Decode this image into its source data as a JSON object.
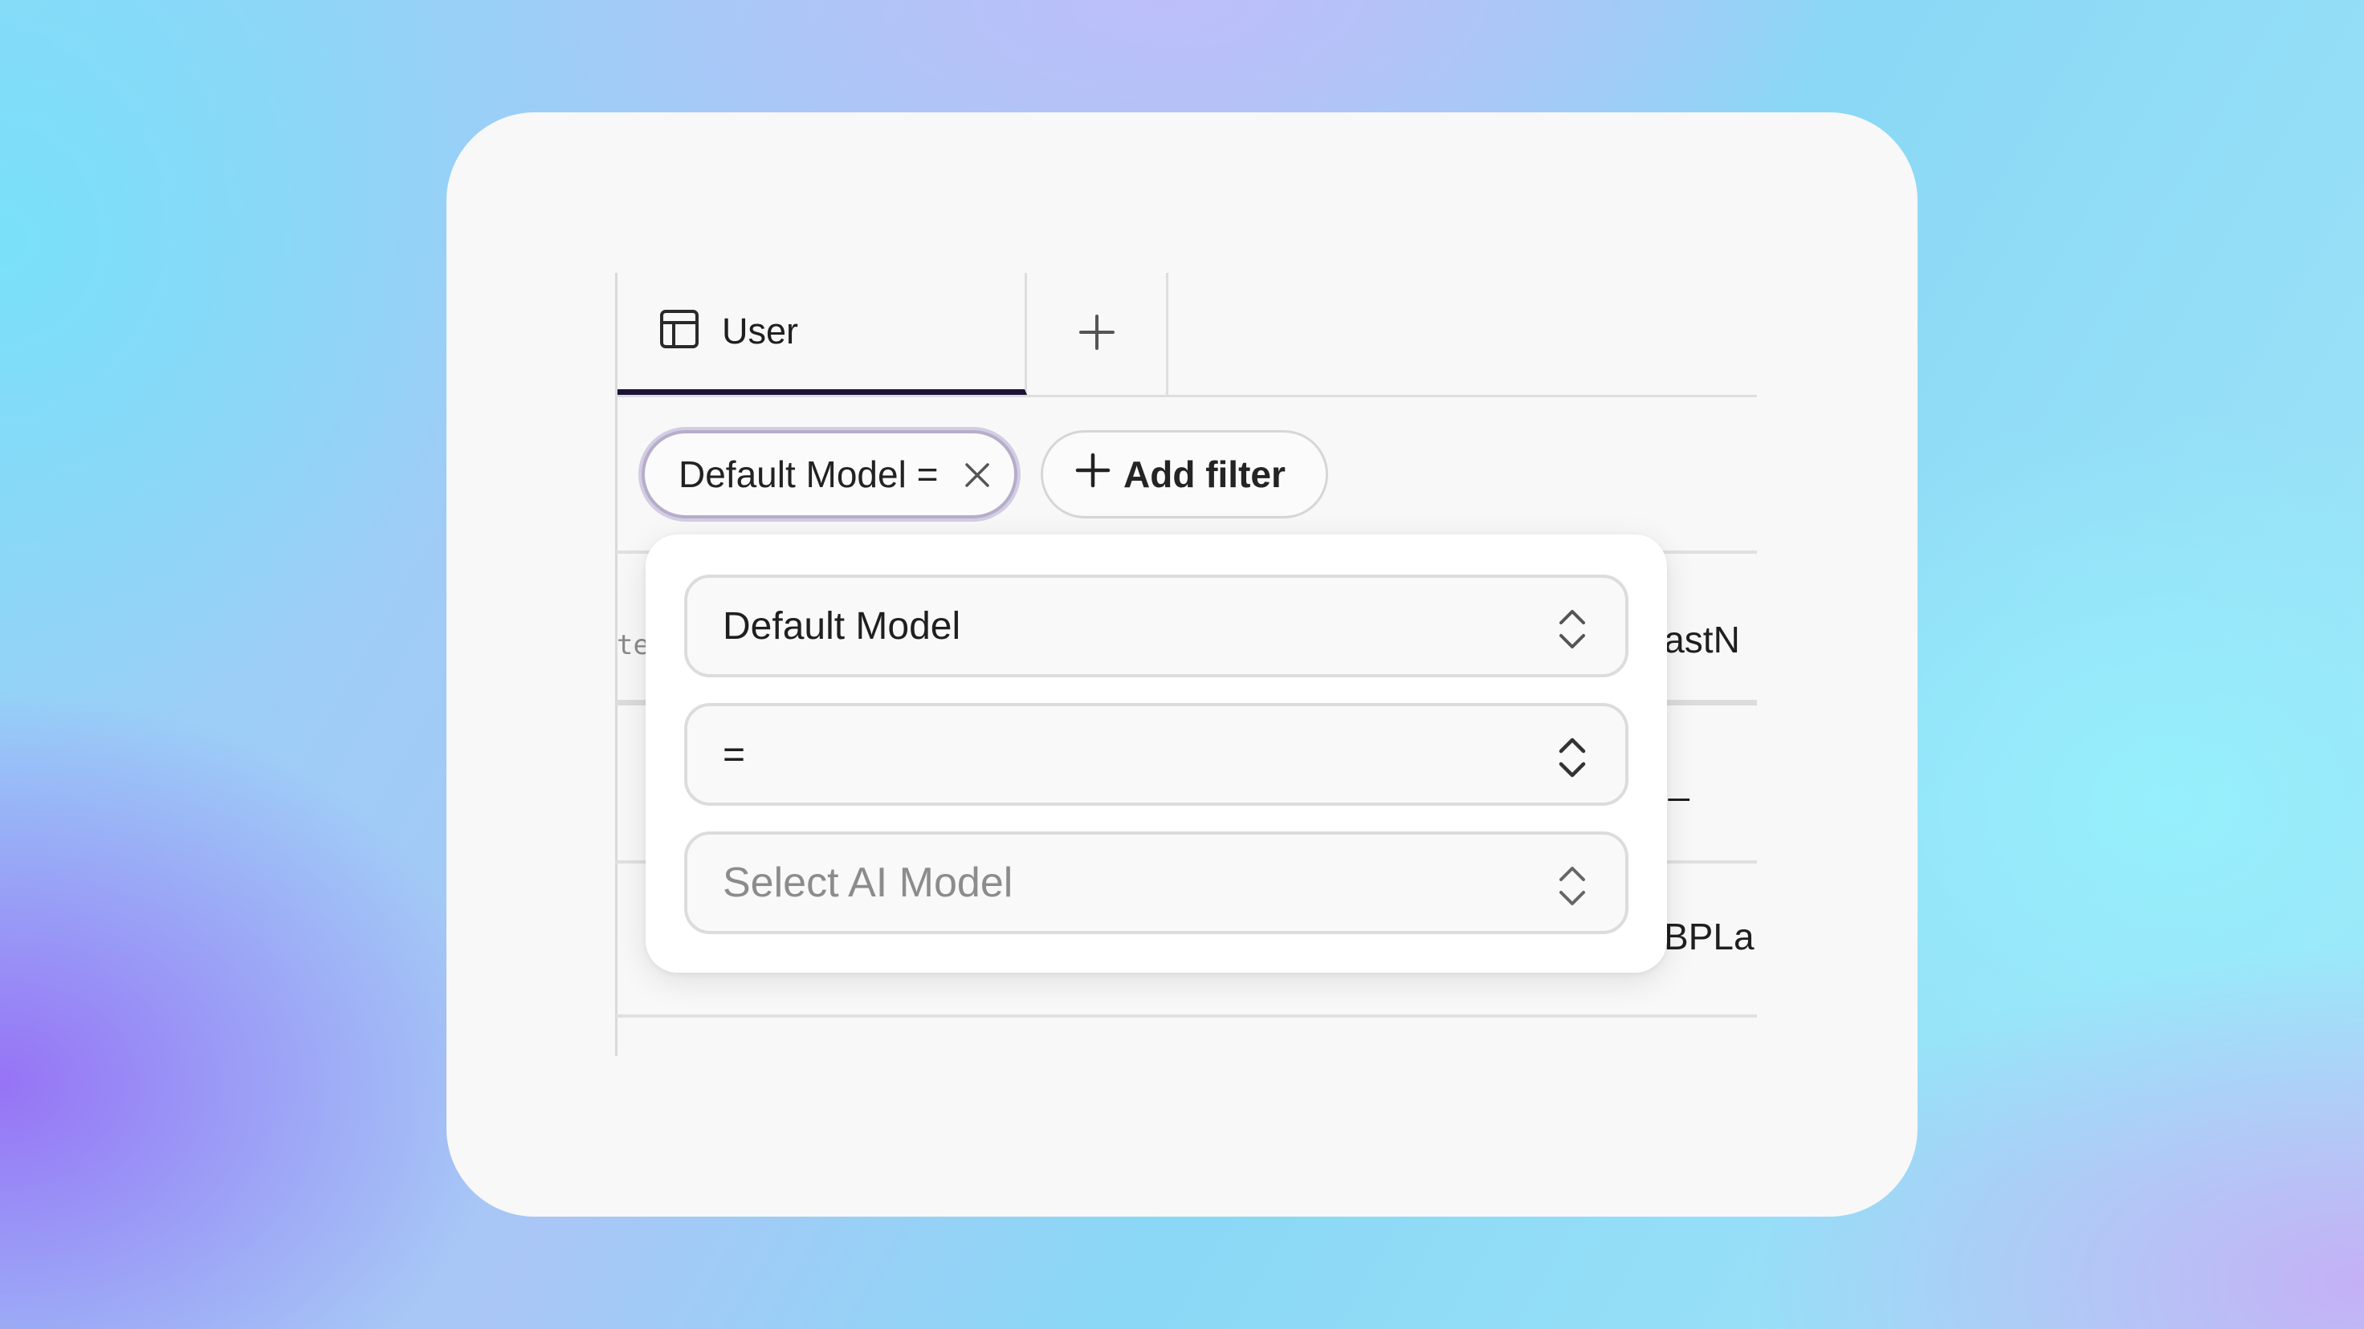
{
  "tabs": {
    "user_label": "User",
    "add_tab_icon": "plus-icon",
    "table_icon": "table-icon"
  },
  "filters": {
    "active_pill_label": "Default Model =",
    "add_filter_label": "Add filter"
  },
  "background_table": {
    "left_header_fragment": "te",
    "right_header_fragment": "lastN",
    "row1_right_fragment": "_",
    "row2_right_fragment": "BPLa"
  },
  "popover": {
    "field_select_value": "Default Model",
    "operator_select_value": "=",
    "value_select_placeholder": "Select AI Model"
  },
  "colors": {
    "active_tab_underline": "#1c1437",
    "active_pill_border": "#b7adc9"
  }
}
